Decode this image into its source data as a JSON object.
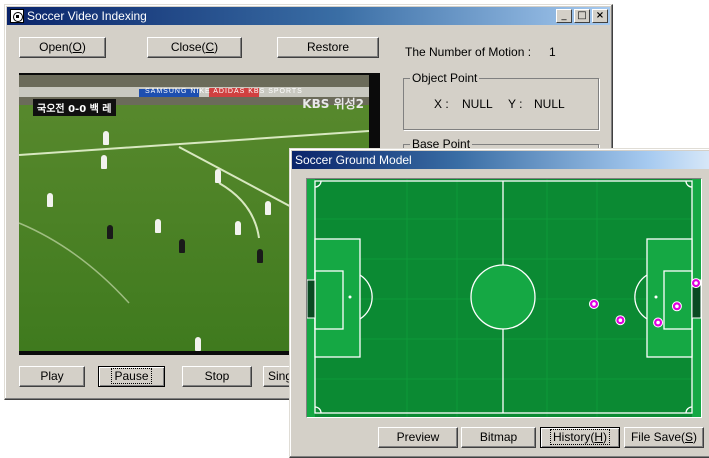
{
  "main_window": {
    "title": "Soccer Video Indexing",
    "controls": {
      "minimize": "_",
      "maximize": "□",
      "close": "×"
    },
    "buttons": {
      "open": {
        "text": "Open(",
        "key": "O",
        "end": ")"
      },
      "close": {
        "text": "Close(",
        "key": "C",
        "end": ")"
      },
      "restore": "Restore",
      "play": "Play",
      "pause": "Pause",
      "stop": "Stop",
      "single": "Sing"
    },
    "motion_label": "The Number of Motion :",
    "motion_value": "1",
    "object_point": {
      "legend": "Object Point",
      "x_label": "X :",
      "x_value": "NULL",
      "y_label": "Y :",
      "y_value": "NULL"
    },
    "base_point": {
      "legend": "Base Point"
    },
    "video": {
      "score_overlay": "국오전 0-0 백 레",
      "channel_overlay": "KBS 위성2",
      "board_text": "SAMSUNG NIKE ADIDAS KBS SPORTS"
    }
  },
  "ground_window": {
    "title": "Soccer Ground Model",
    "buttons": {
      "preview": "Preview",
      "bitmap": "Bitmap",
      "history": {
        "text": "History(",
        "key": "H",
        "end": ")"
      },
      "file_save": {
        "text": "File Save(",
        "key": "S",
        "end": ")"
      }
    },
    "colors": {
      "pitch_dark": "#0b8a33",
      "pitch_light": "#13a242",
      "line": "#ffffff",
      "marker_fill": "#e000e0"
    },
    "markers": [
      {
        "x": 0.74,
        "y": 0.53
      },
      {
        "x": 0.81,
        "y": 0.6
      },
      {
        "x": 0.91,
        "y": 0.61
      },
      {
        "x": 0.96,
        "y": 0.54
      },
      {
        "x": 1.03,
        "y": 0.44
      }
    ]
  }
}
